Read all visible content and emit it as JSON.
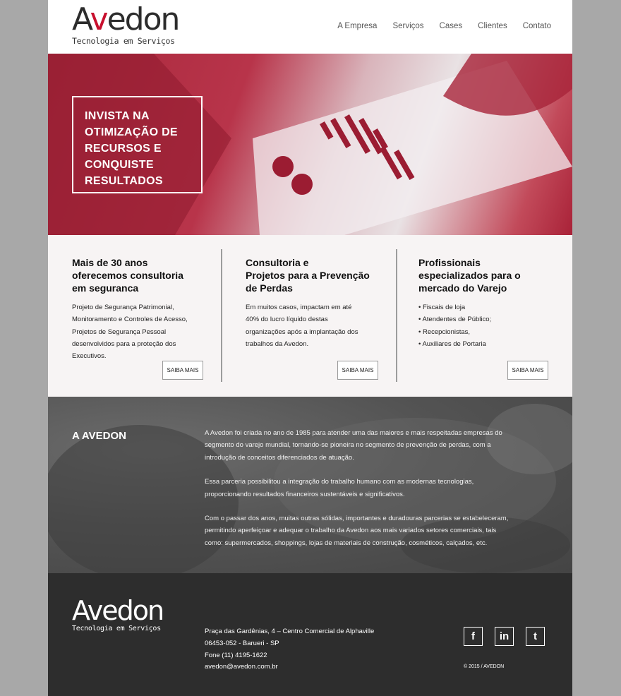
{
  "header": {
    "logo_a": "A",
    "logo_v": "v",
    "logo_rest": "edon",
    "logo_sub": "Tecnologia em Serviços",
    "nav": [
      "A Empresa",
      "Serviços",
      "Cases",
      "Clientes",
      "Contato"
    ]
  },
  "hero": {
    "headline_lines": [
      "INVISTA NA",
      "OTIMIZAÇÃO DE",
      "RECURSOS E",
      "CONQUISTE",
      "RESULTADOS"
    ]
  },
  "features": [
    {
      "title_lines": [
        "Mais de 30 anos",
        "oferecemos consultoria",
        "em  seguranca"
      ],
      "text_lines": [
        "Projeto de Segurança Patrimonial,",
        "Monitoramento e Controles de Acesso,",
        "Projetos de Segurança Pessoal",
        "desenvolvidos para a proteção dos",
        "Executivos."
      ],
      "button": "SAIBA MAIS"
    },
    {
      "title_lines": [
        "Consultoria e",
        "Projetos para a Prevenção",
        "de Perdas"
      ],
      "text_lines": [
        "Em muitos casos, impactam em até",
        "40% do lucro líquido destas",
        "organizações após a implantação dos",
        "trabalhos da Avedon."
      ],
      "button": "SAIBA MAIS"
    },
    {
      "title_lines": [
        "Profissionais",
        "especializados para o",
        "mercado do Varejo"
      ],
      "items": [
        "• Fiscais de loja",
        "• Atendentes de Público;",
        "• Recepcionistas,",
        "• Auxiliares de Portaria"
      ],
      "button": "SAIBA MAIS"
    }
  ],
  "about": {
    "title": "A AVEDON",
    "paragraphs": [
      [
        "A Avedon foi criada no ano de 1985 para atender uma das maiores e mais respeitadas empresas do",
        "segmento do varejo mundial, tornando-se pioneira no segmento de prevenção de perdas, com a",
        "introdução de conceitos diferenciados de atuação."
      ],
      [
        "Essa parceria possibilitou a integração do trabalho humano com as modernas tecnologias,",
        "proporcionando resultados financeiros sustentáveis e significativos."
      ],
      [
        "Com o passar dos anos, muitas outras sólidas, importantes e duradouras parcerias se estabeleceram,",
        "permitindo aperfeiçoar e adequar o trabalho da Avedon aos mais variados setores comerciais, tais",
        "como: supermercados, shoppings, lojas de materiais de construção, cosméticos, calçados, etc."
      ]
    ]
  },
  "footer": {
    "logo_text": "Avedon",
    "logo_sub": "Tecnologia em Serviços",
    "address": [
      "Praça das Gardênias, 4 – Centro Comercial de Alphaville",
      "06453-052 - Barueri - SP",
      "Fone (11) 4195-1622",
      "avedon@avedon.com.br"
    ],
    "social": [
      {
        "name": "facebook-icon",
        "glyph": "f"
      },
      {
        "name": "linkedin-icon",
        "glyph": "in"
      },
      {
        "name": "twitter-icon",
        "glyph": "t"
      }
    ],
    "copyright": "© 2015 / AVEDON"
  },
  "colors": {
    "brand_red": "#c8102e",
    "dark": "#2d2d2d",
    "hero_red": "#b3283c"
  }
}
